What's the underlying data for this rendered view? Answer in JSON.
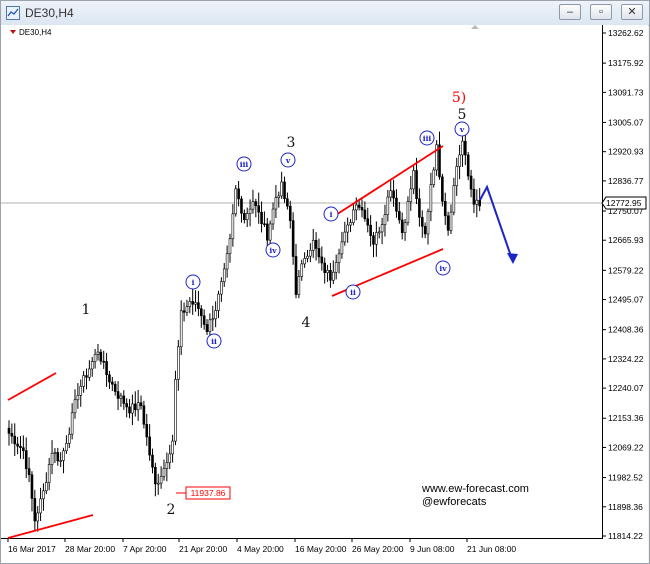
{
  "window": {
    "title": "DE30,H4",
    "minimize_glyph": "–",
    "maximize_glyph": "▫",
    "close_glyph": "✕"
  },
  "chart_data": {
    "type": "candlestick",
    "symbol_label": "DE30,H4",
    "ylim": [
      11814.22,
      13304.0
    ],
    "y_ticks": [
      "13262.62",
      "13175.92",
      "13091.73",
      "13005.07",
      "12920.93",
      "12836.77",
      "12750.07",
      "12665.93",
      "12579.22",
      "12495.07",
      "12408.36",
      "12324.22",
      "12240.07",
      "12153.36",
      "12069.22",
      "11982.52",
      "11898.36",
      "11814.22"
    ],
    "x_ticks": [
      "16 Mar 2017",
      "28 Mar 20:00",
      "7 Apr 20:00",
      "21 Apr 20:00",
      "4 May 20:00",
      "16 May 20:00",
      "26 May 20:00",
      "9 Jun 08:00",
      "21 Jun 08:00"
    ],
    "current_price": "12772.95",
    "low_price_label": "11937.86",
    "price_anchors": [
      [
        0,
        12110
      ],
      [
        5,
        12060
      ],
      [
        7,
        11980
      ],
      [
        9,
        11860
      ],
      [
        12,
        11940
      ],
      [
        15,
        12060
      ],
      [
        18,
        12030
      ],
      [
        21,
        12120
      ],
      [
        24,
        12230
      ],
      [
        27,
        12280
      ],
      [
        31,
        12350
      ],
      [
        34,
        12280
      ],
      [
        38,
        12220
      ],
      [
        42,
        12180
      ],
      [
        46,
        12190
      ],
      [
        49,
        12050
      ],
      [
        51,
        11960
      ],
      [
        54,
        12010
      ],
      [
        57,
        12090
      ],
      [
        58,
        12260
      ],
      [
        60,
        12450
      ],
      [
        63,
        12490
      ],
      [
        66,
        12470
      ],
      [
        69,
        12410
      ],
      [
        72,
        12470
      ],
      [
        75,
        12570
      ],
      [
        77,
        12660
      ],
      [
        79,
        12810
      ],
      [
        82,
        12730
      ],
      [
        85,
        12780
      ],
      [
        88,
        12720
      ],
      [
        90,
        12680
      ],
      [
        93,
        12790
      ],
      [
        95,
        12820
      ],
      [
        98,
        12720
      ],
      [
        100,
        12520
      ],
      [
        103,
        12620
      ],
      [
        106,
        12660
      ],
      [
        109,
        12590
      ],
      [
        112,
        12560
      ],
      [
        115,
        12640
      ],
      [
        118,
        12700
      ],
      [
        121,
        12780
      ],
      [
        124,
        12740
      ],
      [
        127,
        12660
      ],
      [
        130,
        12720
      ],
      [
        133,
        12820
      ],
      [
        135,
        12760
      ],
      [
        137,
        12690
      ],
      [
        139,
        12770
      ],
      [
        141,
        12860
      ],
      [
        143,
        12720
      ],
      [
        145,
        12680
      ],
      [
        147,
        12830
      ],
      [
        149,
        12930
      ],
      [
        151,
        12790
      ],
      [
        153,
        12700
      ],
      [
        156,
        12880
      ],
      [
        158,
        12950
      ],
      [
        160,
        12850
      ],
      [
        162,
        12780
      ],
      [
        164,
        12760
      ]
    ],
    "wave_labels": {
      "primary": [
        "1",
        "2",
        "3",
        "4",
        "5"
      ],
      "primary_final": "5)",
      "sub_first_set": [
        "i",
        "ii",
        "iii",
        "iv",
        "v"
      ],
      "sub_second_set": [
        "i",
        "ii",
        "iii",
        "iv",
        "v"
      ]
    },
    "colors": {
      "candle": "#000000",
      "trendline": "#ff0000",
      "wave_label": "#111111",
      "subwave_label": "#1c24c8",
      "projection_arrow": "#1c24c8",
      "final_label": "#ff0000",
      "grid_price_line": "#b0b0b0"
    }
  },
  "watermark": {
    "url": "www.ew-forecast.com",
    "handle": "@ewforecats"
  }
}
